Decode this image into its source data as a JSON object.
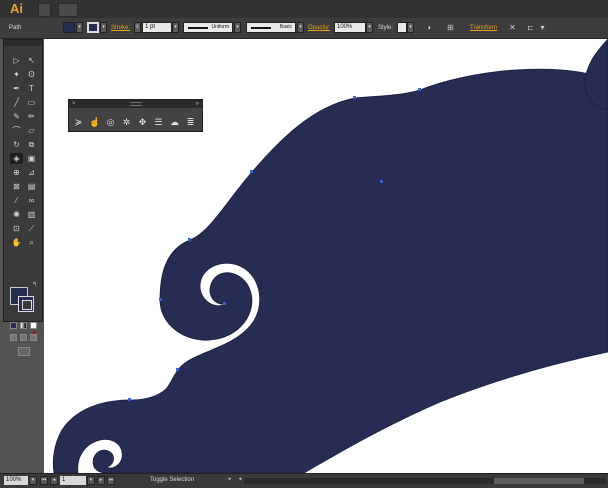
{
  "app": {
    "logo": "Ai"
  },
  "control_bar": {
    "selection_label": "Path",
    "stroke_label": "Stroke:",
    "stroke_weight": "1 pt",
    "stroke_profile": "Uniform",
    "brush": "Basic",
    "opacity_label": "Opacity:",
    "opacity_value": "100%",
    "style_label": "Style:",
    "transform_label": "Transform"
  },
  "status_bar": {
    "zoom": "100%",
    "page": "1",
    "status_text": "Toggle Selection"
  },
  "colors": {
    "shape_fill": "#262c52",
    "accent_orange": "#e8a323",
    "canvas_bg": "#ffffff",
    "ui_dark": "#3a3a3a"
  },
  "icons": {
    "floating_panel": [
      "width-tool-icon",
      "warp-icon",
      "twirl-icon",
      "pucker-icon",
      "bloat-icon",
      "scallop-icon",
      "crystallize-icon",
      "wrinkle-icon"
    ]
  }
}
